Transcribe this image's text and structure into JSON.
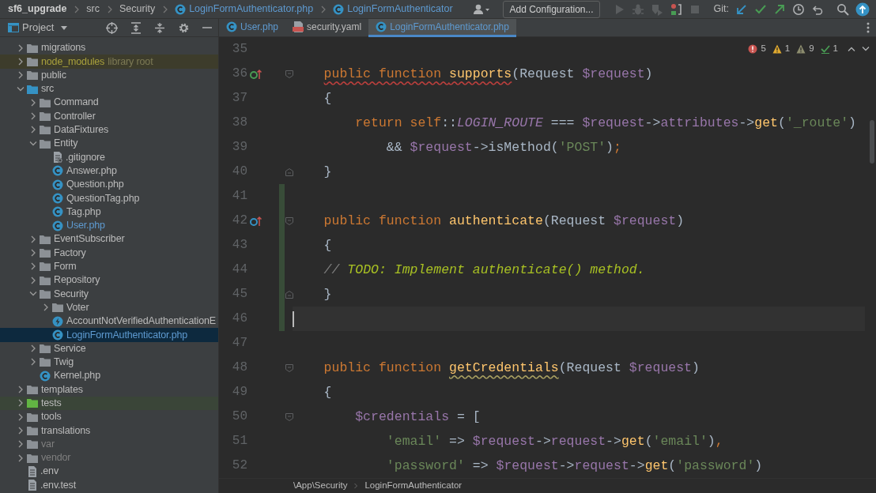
{
  "title_bar": {
    "breadcrumbs": [
      {
        "text": "sf6_upgrade",
        "kind": "project"
      },
      {
        "text": "src",
        "kind": "folder"
      },
      {
        "text": "Security",
        "kind": "folder"
      },
      {
        "text": "LoginFormAuthenticator.php",
        "kind": "class-file"
      },
      {
        "text": "LoginFormAuthenticator",
        "kind": "class"
      }
    ],
    "run_configuration": "Add Configuration...",
    "vcs_label": "Git:"
  },
  "project_panel": {
    "title": "Project",
    "tree": [
      {
        "label": "migrations",
        "kind": "folder",
        "expanded": false,
        "selected": false
      },
      {
        "label": "node_modules",
        "note": "library root",
        "kind": "library-folder",
        "expanded": false,
        "selected": false
      },
      {
        "label": "public",
        "kind": "folder",
        "expanded": false,
        "selected": false
      },
      {
        "label": "src",
        "kind": "source-folder",
        "expanded": true,
        "selected": false,
        "children": [
          {
            "label": "Command",
            "kind": "folder",
            "expanded": false,
            "selected": false
          },
          {
            "label": "Controller",
            "kind": "folder",
            "expanded": false,
            "selected": false
          },
          {
            "label": "DataFixtures",
            "kind": "folder",
            "expanded": false,
            "selected": false
          },
          {
            "label": "Entity",
            "kind": "folder",
            "expanded": true,
            "selected": false,
            "children": [
              {
                "label": ".gitignore",
                "kind": "ignore-file",
                "selected": false
              },
              {
                "label": "Answer.php",
                "kind": "class-file",
                "selected": false
              },
              {
                "label": "Question.php",
                "kind": "class-file",
                "selected": false
              },
              {
                "label": "QuestionTag.php",
                "kind": "class-file",
                "selected": false
              },
              {
                "label": "Tag.php",
                "kind": "class-file",
                "selected": false
              },
              {
                "label": "User.php",
                "kind": "class-file",
                "modified": true,
                "selected": false
              }
            ]
          },
          {
            "label": "EventSubscriber",
            "kind": "folder",
            "expanded": false,
            "selected": false
          },
          {
            "label": "Factory",
            "kind": "folder",
            "expanded": false,
            "selected": false
          },
          {
            "label": "Form",
            "kind": "folder",
            "expanded": false,
            "selected": false
          },
          {
            "label": "Repository",
            "kind": "folder",
            "expanded": false,
            "selected": false
          },
          {
            "label": "Security",
            "kind": "folder",
            "expanded": true,
            "selected": false,
            "children": [
              {
                "label": "Voter",
                "kind": "folder",
                "expanded": false,
                "selected": false
              },
              {
                "label": "AccountNotVerifiedAuthenticationE",
                "kind": "exception-class",
                "selected": false
              },
              {
                "label": "LoginFormAuthenticator.php",
                "kind": "class-file",
                "modified": true,
                "selected": true
              }
            ]
          },
          {
            "label": "Service",
            "kind": "folder",
            "expanded": false,
            "selected": false
          },
          {
            "label": "Twig",
            "kind": "folder",
            "expanded": false,
            "selected": false
          },
          {
            "label": "Kernel.php",
            "kind": "class-file",
            "selected": false
          }
        ]
      },
      {
        "label": "templates",
        "kind": "folder",
        "expanded": false,
        "selected": false
      },
      {
        "label": "tests",
        "kind": "test-folder",
        "expanded": false,
        "selected": false
      },
      {
        "label": "tools",
        "kind": "folder",
        "expanded": false,
        "selected": false
      },
      {
        "label": "translations",
        "kind": "folder",
        "expanded": false,
        "selected": false
      },
      {
        "label": "var",
        "kind": "excluded-folder",
        "expanded": false,
        "selected": false
      },
      {
        "label": "vendor",
        "kind": "excluded-folder",
        "expanded": false,
        "selected": false
      },
      {
        "label": ".env",
        "kind": "text-file",
        "selected": false
      },
      {
        "label": ".env.test",
        "kind": "text-file",
        "selected": false
      }
    ]
  },
  "editor_tabs": [
    {
      "label": "User.php",
      "kind": "class-file",
      "modified": true,
      "selected": false
    },
    {
      "label": "security.yaml",
      "kind": "yaml-file",
      "selected": false
    },
    {
      "label": "LoginFormAuthenticator.php",
      "kind": "class-file",
      "modified": true,
      "selected": true
    }
  ],
  "inspections": [
    {
      "kind": "error",
      "count": "5"
    },
    {
      "kind": "warning",
      "count": "1"
    },
    {
      "kind": "weak-warning",
      "count": "9"
    },
    {
      "kind": "typo",
      "count": "1"
    }
  ],
  "code_lines": [
    {
      "number": "35"
    },
    {
      "number": "36",
      "overrides": true,
      "fold_start": true,
      "tokens": [
        {
          "kind": "keyword",
          "text": "    public function ",
          "error_underline": true
        },
        {
          "kind": "function",
          "text": "supports",
          "error_underline": true
        },
        {
          "kind": "plain",
          "text": "(Request "
        },
        {
          "kind": "variable",
          "text": "$request"
        },
        {
          "kind": "plain",
          "text": ")"
        }
      ]
    },
    {
      "number": "37",
      "tokens": [
        {
          "kind": "plain",
          "text": "    {"
        }
      ]
    },
    {
      "number": "38",
      "tokens": [
        {
          "kind": "keyword",
          "text": "        return self"
        },
        {
          "kind": "plain",
          "text": "::"
        },
        {
          "kind": "constant",
          "text": "LOGIN_ROUTE"
        },
        {
          "kind": "plain",
          "text": " === "
        },
        {
          "kind": "variable",
          "text": "$request"
        },
        {
          "kind": "plain",
          "text": "->"
        },
        {
          "kind": "field",
          "text": "attributes"
        },
        {
          "kind": "plain",
          "text": "->"
        },
        {
          "kind": "method",
          "text": "get"
        },
        {
          "kind": "plain",
          "text": "("
        },
        {
          "kind": "string",
          "text": "'_route'"
        },
        {
          "kind": "plain",
          "text": ")"
        }
      ]
    },
    {
      "number": "39",
      "tokens": [
        {
          "kind": "plain",
          "text": "            && "
        },
        {
          "kind": "variable",
          "text": "$request"
        },
        {
          "kind": "plain",
          "text": "->isMethod("
        },
        {
          "kind": "string",
          "text": "'POST'"
        },
        {
          "kind": "plain",
          "text": ")"
        },
        {
          "kind": "keyword",
          "text": ";"
        }
      ]
    },
    {
      "number": "40",
      "fold_end": true,
      "tokens": [
        {
          "kind": "plain",
          "text": "    }"
        }
      ]
    },
    {
      "number": "41",
      "changed": true
    },
    {
      "number": "42",
      "implements": true,
      "fold_start": true,
      "changed": true,
      "tokens": [
        {
          "kind": "keyword",
          "text": "    public function "
        },
        {
          "kind": "function",
          "text": "authenticate"
        },
        {
          "kind": "plain",
          "text": "(Request "
        },
        {
          "kind": "variable",
          "text": "$request"
        },
        {
          "kind": "plain",
          "text": ")"
        }
      ]
    },
    {
      "number": "43",
      "changed": true,
      "tokens": [
        {
          "kind": "plain",
          "text": "    {"
        }
      ]
    },
    {
      "number": "44",
      "changed": true,
      "tokens": [
        {
          "kind": "comment",
          "text": "    // "
        },
        {
          "kind": "todo",
          "text": "TODO: Implement authenticate() method."
        }
      ]
    },
    {
      "number": "45",
      "fold_end": true,
      "changed": true,
      "tokens": [
        {
          "kind": "plain",
          "text": "    }"
        }
      ]
    },
    {
      "number": "46",
      "changed": true,
      "current": true
    },
    {
      "number": "47"
    },
    {
      "number": "48",
      "fold_start": true,
      "tokens": [
        {
          "kind": "keyword",
          "text": "    public function "
        },
        {
          "kind": "function",
          "text": "getCredentials",
          "warning_underline": true
        },
        {
          "kind": "plain",
          "text": "(Request "
        },
        {
          "kind": "variable",
          "text": "$request"
        },
        {
          "kind": "plain",
          "text": ")"
        }
      ]
    },
    {
      "number": "49",
      "tokens": [
        {
          "kind": "plain",
          "text": "    {"
        }
      ]
    },
    {
      "number": "50",
      "fold_start": true,
      "tokens": [
        {
          "kind": "variable",
          "text": "        $credentials"
        },
        {
          "kind": "plain",
          "text": " = ["
        }
      ]
    },
    {
      "number": "51",
      "tokens": [
        {
          "kind": "string",
          "text": "            'email'"
        },
        {
          "kind": "plain",
          "text": " => "
        },
        {
          "kind": "variable",
          "text": "$request"
        },
        {
          "kind": "plain",
          "text": "->"
        },
        {
          "kind": "field",
          "text": "request"
        },
        {
          "kind": "plain",
          "text": "->"
        },
        {
          "kind": "method",
          "text": "get"
        },
        {
          "kind": "plain",
          "text": "("
        },
        {
          "kind": "string",
          "text": "'email'"
        },
        {
          "kind": "plain",
          "text": ")"
        },
        {
          "kind": "keyword",
          "text": ","
        }
      ]
    },
    {
      "number": "52",
      "tokens": [
        {
          "kind": "string",
          "text": "            'password'"
        },
        {
          "kind": "plain",
          "text": " => "
        },
        {
          "kind": "variable",
          "text": "$request"
        },
        {
          "kind": "plain",
          "text": "->"
        },
        {
          "kind": "field",
          "text": "request"
        },
        {
          "kind": "plain",
          "text": "->"
        },
        {
          "kind": "method",
          "text": "get"
        },
        {
          "kind": "plain",
          "text": "("
        },
        {
          "kind": "string",
          "text": "'password'"
        },
        {
          "kind": "plain",
          "text": ")"
        }
      ]
    }
  ],
  "navigation_bar": [
    "\\App\\Security",
    "LoginFormAuthenticator"
  ]
}
